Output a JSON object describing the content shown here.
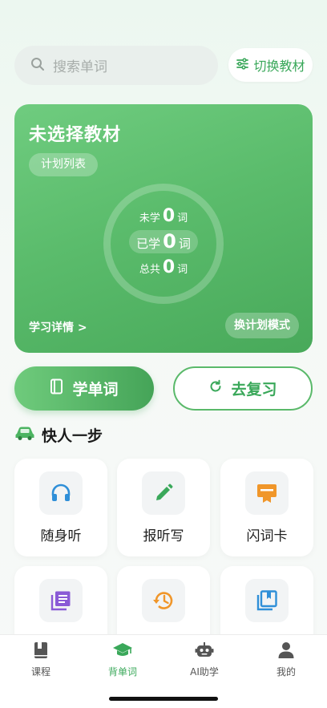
{
  "search": {
    "placeholder": "搜索单词",
    "icon": "search-icon"
  },
  "switch_button": {
    "label": "切换教材",
    "icon": "sliders-icon"
  },
  "hero": {
    "title": "未选择教材",
    "plan_chip": "计划列表",
    "stats": {
      "unlearned": {
        "prefix": "未学",
        "value": "0",
        "unit": "词"
      },
      "learned": {
        "prefix": "已学",
        "value": "0",
        "unit": "词"
      },
      "total": {
        "prefix": "总共",
        "value": "0",
        "unit": "词"
      }
    },
    "detail_link": "学习详情 >",
    "mode_button": "换计划模式"
  },
  "actions": {
    "learn": {
      "label": "学单词",
      "icon": "book-icon"
    },
    "review": {
      "label": "去复习",
      "icon": "refresh-icon"
    }
  },
  "section": {
    "title": "快人一步",
    "icon": "car-icon"
  },
  "cards": [
    {
      "label": "随身听",
      "icon": "headphones-icon",
      "color": "#2f8fd8"
    },
    {
      "label": "报听写",
      "icon": "pencil-icon",
      "color": "#3aa85a"
    },
    {
      "label": "闪词卡",
      "icon": "flashcard-icon",
      "color": "#f0962a"
    },
    {
      "label": "",
      "icon": "library-icon",
      "color": "#8a5ad6"
    },
    {
      "label": "",
      "icon": "history-icon",
      "color": "#f0962a"
    },
    {
      "label": "",
      "icon": "bookmark-book-icon",
      "color": "#2f8fd8"
    }
  ],
  "tabs": [
    {
      "label": "课程",
      "icon": "course-book-icon",
      "active": false
    },
    {
      "label": "背单词",
      "icon": "graduation-cap-icon",
      "active": true
    },
    {
      "label": "AI助学",
      "icon": "robot-icon",
      "active": false
    },
    {
      "label": "我的",
      "icon": "user-icon",
      "active": false
    }
  ],
  "colors": {
    "accent": "#3aa85a",
    "hero_start": "#6fcc7f",
    "hero_end": "#48a95a"
  }
}
